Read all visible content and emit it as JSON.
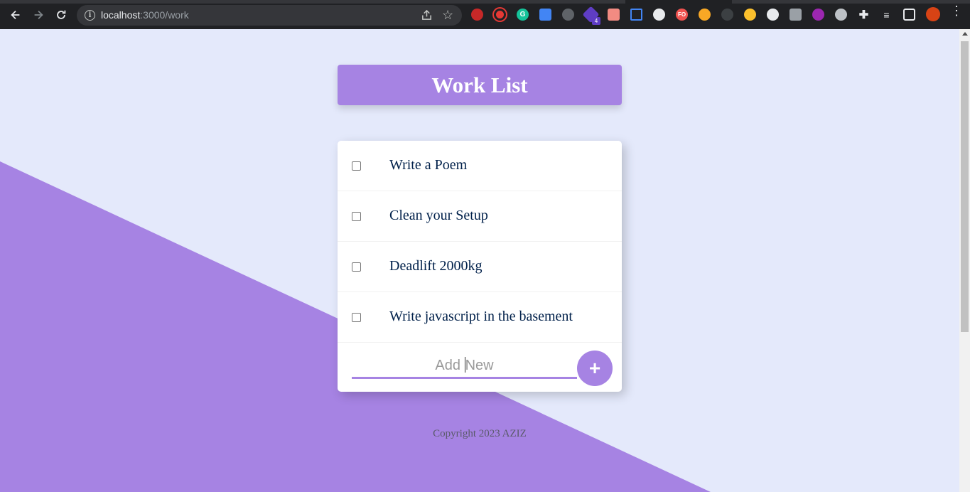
{
  "browser": {
    "url_host": "localhost",
    "url_path": ":3000/work",
    "extension_badge": "4",
    "extension_label_fo": "FO",
    "extension_label_g": "G"
  },
  "page": {
    "title": "Work List",
    "items": [
      {
        "label": "Write a Poem",
        "checked": false
      },
      {
        "label": "Clean your Setup",
        "checked": false
      },
      {
        "label": "Deadlift 2000kg",
        "checked": false
      },
      {
        "label": "Write javascript in the basement",
        "checked": false
      }
    ],
    "new_item": {
      "placeholder_before": "Add ",
      "placeholder_after": "New",
      "button_label": "+"
    },
    "footer": "Copyright 2023 AZIZ"
  },
  "colors": {
    "accent": "#a683e3",
    "background": "#e4e9fb",
    "text": "#00204a",
    "chrome": "#202124"
  }
}
